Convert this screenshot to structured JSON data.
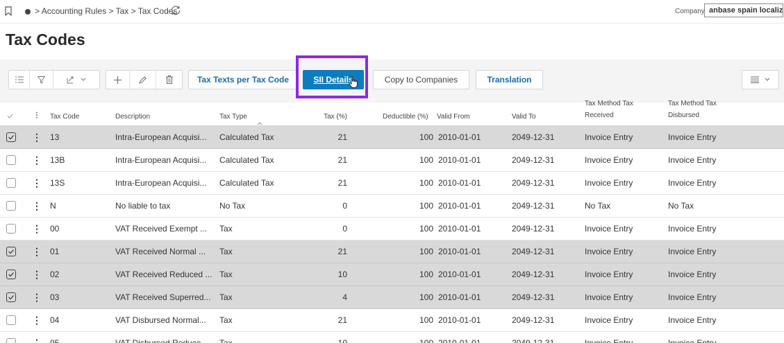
{
  "breadcrumb": {
    "items": [
      "Accounting Rules",
      "Tax",
      "Tax Codes"
    ],
    "separator": ">"
  },
  "company": {
    "label": "Company",
    "value": "anbase spain localization"
  },
  "page_title": "Tax Codes",
  "toolbar": {
    "tax_texts_label": "Tax Texts per Tax Code",
    "sii_details_label": "SII Details",
    "copy_to_companies_label": "Copy to Companies",
    "translation_label": "Translation"
  },
  "table": {
    "columns": {
      "tax_code": "Tax Code",
      "description": "Description",
      "tax_type": "Tax Type",
      "tax_pct": "Tax (%)",
      "deductible": "Deductible (%)",
      "valid_from": "Valid From",
      "valid_to": "Valid To",
      "method_received_1": "Tax Method Tax",
      "method_received_2": "Received",
      "method_disbursed_1": "Tax Method Tax",
      "method_disbursed_2": "Disbursed"
    },
    "rows": [
      {
        "selected": true,
        "code": "13",
        "desc": "Intra-European Acquisi...",
        "type": "Calculated Tax",
        "tax": "21",
        "ded": "100",
        "from": "2010-01-01",
        "to": "2049-12-31",
        "received": "Invoice Entry",
        "disbursed": "Invoice Entry"
      },
      {
        "selected": false,
        "code": "13B",
        "desc": "Intra-European Acquisi...",
        "type": "Calculated Tax",
        "tax": "21",
        "ded": "100",
        "from": "2010-01-01",
        "to": "2049-12-31",
        "received": "Invoice Entry",
        "disbursed": "Invoice Entry"
      },
      {
        "selected": false,
        "code": "13S",
        "desc": "Intra-European Acquisi...",
        "type": "Calculated Tax",
        "tax": "21",
        "ded": "100",
        "from": "2010-01-01",
        "to": "2049-12-31",
        "received": "Invoice Entry",
        "disbursed": "Invoice Entry"
      },
      {
        "selected": false,
        "code": "N",
        "desc": "No liable to tax",
        "type": "No Tax",
        "tax": "0",
        "ded": "100",
        "from": "2010-01-01",
        "to": "2049-12-31",
        "received": "No Tax",
        "disbursed": "No Tax"
      },
      {
        "selected": false,
        "code": "00",
        "desc": "VAT Received Exempt ...",
        "type": "Tax",
        "tax": "0",
        "ded": "100",
        "from": "2010-01-01",
        "to": "2049-12-31",
        "received": "Invoice Entry",
        "disbursed": "Invoice Entry"
      },
      {
        "selected": true,
        "code": "01",
        "desc": "VAT Received Normal ...",
        "type": "Tax",
        "tax": "21",
        "ded": "100",
        "from": "2010-01-01",
        "to": "2049-12-31",
        "received": "Invoice Entry",
        "disbursed": "Invoice Entry"
      },
      {
        "selected": true,
        "code": "02",
        "desc": "VAT Received Reduced ...",
        "type": "Tax",
        "tax": "10",
        "ded": "100",
        "from": "2010-01-01",
        "to": "2049-12-31",
        "received": "Invoice Entry",
        "disbursed": "Invoice Entry"
      },
      {
        "selected": true,
        "code": "03",
        "desc": "VAT Received Superred...",
        "type": "Tax",
        "tax": "4",
        "ded": "100",
        "from": "2010-01-01",
        "to": "2049-12-31",
        "received": "Invoice Entry",
        "disbursed": "Invoice Entry"
      },
      {
        "selected": false,
        "code": "04",
        "desc": "VAT Disbursed Normal...",
        "type": "Tax",
        "tax": "21",
        "ded": "100",
        "from": "2010-01-01",
        "to": "2049-12-31",
        "received": "Invoice Entry",
        "disbursed": "Invoice Entry"
      },
      {
        "selected": false,
        "code": "05",
        "desc": "VAT Disbursed Reduce...",
        "type": "Tax",
        "tax": "10",
        "ded": "100",
        "from": "2010-01-01",
        "to": "2049-12-31",
        "received": "Invoice Entry",
        "disbursed": "Invoice Entry"
      }
    ]
  },
  "colors": {
    "accent": "#0c7cbf",
    "link": "#1a6aa8",
    "highlight": "#8a2be2",
    "selected_row": "#d9d9d9"
  },
  "icons": {
    "bookmark": "bookmark-icon",
    "home": "home-icon",
    "refresh": "refresh-icon",
    "list": "list-icon",
    "filter": "filter-icon",
    "export": "export-icon",
    "add": "plus-icon",
    "edit": "pencil-icon",
    "delete": "trash-icon",
    "column_chooser": "columns-icon"
  }
}
